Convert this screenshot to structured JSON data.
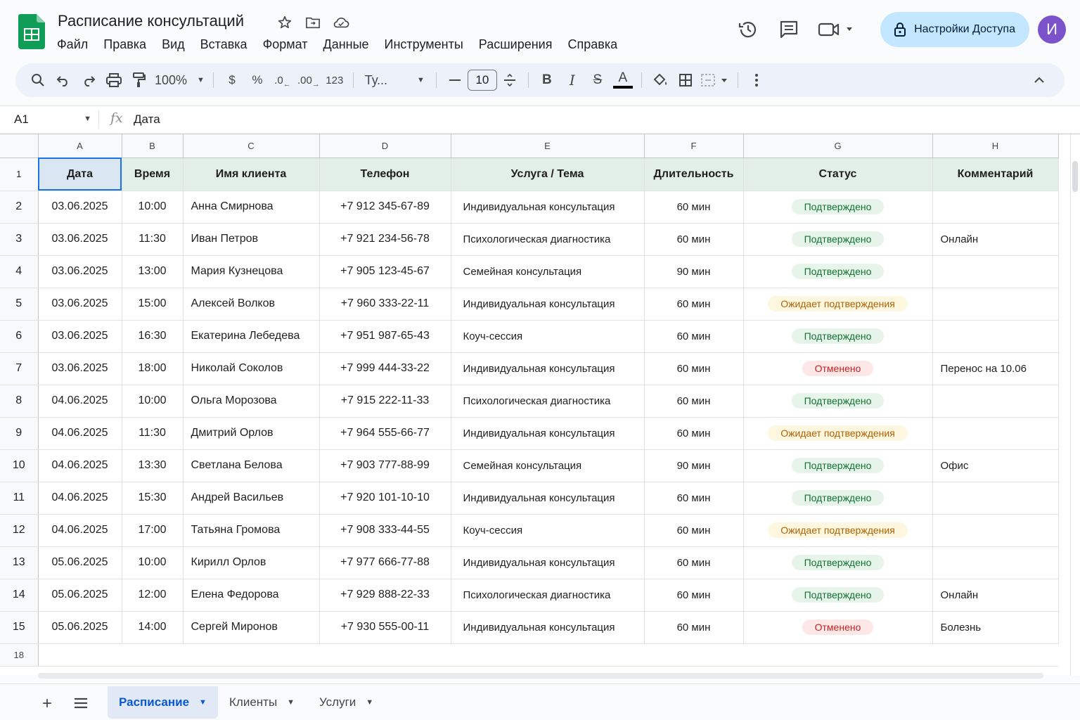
{
  "doc": {
    "title": "Расписание консультаций"
  },
  "menu": [
    "Файл",
    "Правка",
    "Вид",
    "Вставка",
    "Формат",
    "Данные",
    "Инструменты",
    "Расширения",
    "Справка"
  ],
  "share": {
    "label": "Настройки Доступа"
  },
  "avatar": {
    "initial": "И",
    "color": "#7b52c9"
  },
  "toolbar": {
    "zoom": "100%",
    "currency": "$",
    "percent": "%",
    "dec_less": ".0",
    "dec_more": ".00",
    "number_format": "123",
    "font": "Ту...",
    "font_size": "10",
    "bold": "B",
    "italic": "I",
    "strike": "S",
    "text_color": "A"
  },
  "formula_bar": {
    "cell_ref": "A1",
    "fx": "fx",
    "value": "Дата"
  },
  "columns": [
    "A",
    "B",
    "C",
    "D",
    "E",
    "F",
    "G",
    "H"
  ],
  "header_row": {
    "num": "1",
    "cells": [
      "Дата",
      "Время",
      "Имя клиента",
      "Телефон",
      "Услуга / Тема",
      "Длительность",
      "Статус",
      "Комментарий"
    ]
  },
  "rows": [
    {
      "num": "2",
      "date": "03.06.2025",
      "time": "10:00",
      "name": "Анна Смирнова",
      "phone": "+7 912 345-67-89",
      "service": "Индивидуальная консультация",
      "duration": "60 мин",
      "status": "Подтверждено",
      "status_kind": "ok",
      "comment": ""
    },
    {
      "num": "3",
      "date": "03.06.2025",
      "time": "11:30",
      "name": "Иван Петров",
      "phone": "+7 921 234-56-78",
      "service": "Психологическая диагностика",
      "duration": "60 мин",
      "status": "Подтверждено",
      "status_kind": "ok",
      "comment": "Онлайн"
    },
    {
      "num": "4",
      "date": "03.06.2025",
      "time": "13:00",
      "name": "Мария Кузнецова",
      "phone": "+7 905 123-45-67",
      "service": "Семейная консультация",
      "duration": "90 мин",
      "status": "Подтверждено",
      "status_kind": "ok",
      "comment": ""
    },
    {
      "num": "5",
      "date": "03.06.2025",
      "time": "15:00",
      "name": "Алексей Волков",
      "phone": "+7 960 333-22-11",
      "service": "Индивидуальная консультация",
      "duration": "60 мин",
      "status": "Ожидает подтверждения",
      "status_kind": "wait",
      "comment": ""
    },
    {
      "num": "6",
      "date": "03.06.2025",
      "time": "16:30",
      "name": "Екатерина Лебедева",
      "phone": "+7 951 987-65-43",
      "service": "Коуч-сессия",
      "duration": "60 мин",
      "status": "Подтверждено",
      "status_kind": "ok",
      "comment": ""
    },
    {
      "num": "7",
      "date": "03.06.2025",
      "time": "18:00",
      "name": "Николай Соколов",
      "phone": "+7 999 444-33-22",
      "service": "Индивидуальная консультация",
      "duration": "60 мин",
      "status": "Отменено",
      "status_kind": "cancel",
      "comment": "Перенос на 10.06"
    },
    {
      "num": "8",
      "date": "04.06.2025",
      "time": "10:00",
      "name": "Ольга Морозова",
      "phone": "+7 915 222-11-33",
      "service": "Психологическая диагностика",
      "duration": "60 мин",
      "status": "Подтверждено",
      "status_kind": "ok",
      "comment": ""
    },
    {
      "num": "9",
      "date": "04.06.2025",
      "time": "11:30",
      "name": "Дмитрий Орлов",
      "phone": "+7 964 555-66-77",
      "service": "Индивидуальная консультация",
      "duration": "60 мин",
      "status": "Ожидает подтверждения",
      "status_kind": "wait",
      "comment": ""
    },
    {
      "num": "10",
      "date": "04.06.2025",
      "time": "13:30",
      "name": "Светлана Белова",
      "phone": "+7 903 777-88-99",
      "service": "Семейная консультация",
      "duration": "90 мин",
      "status": "Подтверждено",
      "status_kind": "ok",
      "comment": "Офис"
    },
    {
      "num": "11",
      "date": "04.06.2025",
      "time": "15:30",
      "name": "Андрей Васильев",
      "phone": "+7 920 101-10-10",
      "service": "Индивидуальная консультация",
      "duration": "60 мин",
      "status": "Подтверждено",
      "status_kind": "ok",
      "comment": ""
    },
    {
      "num": "12",
      "date": "04.06.2025",
      "time": "17:00",
      "name": "Татьяна Громова",
      "phone": "+7 908 333-44-55",
      "service": "Коуч-сессия",
      "duration": "60 мин",
      "status": "Ожидает подтверждения",
      "status_kind": "wait",
      "comment": ""
    },
    {
      "num": "13",
      "date": "05.06.2025",
      "time": "10:00",
      "name": "Кирилл Орлов",
      "phone": "+7 977 666-77-88",
      "service": "Индивидуальная консультация",
      "duration": "60 мин",
      "status": "Подтверждено",
      "status_kind": "ok",
      "comment": ""
    },
    {
      "num": "14",
      "date": "05.06.2025",
      "time": "12:00",
      "name": "Елена Федорова",
      "phone": "+7 929 888-22-33",
      "service": "Психологическая диагностика",
      "duration": "60 мин",
      "status": "Подтверждено",
      "status_kind": "ok",
      "comment": "Онлайн"
    },
    {
      "num": "15",
      "date": "05.06.2025",
      "time": "14:00",
      "name": "Сергей Миронов",
      "phone": "+7 930 555-00-11",
      "service": "Индивидуальная консультация",
      "duration": "60 мин",
      "status": "Отменено",
      "status_kind": "cancel",
      "comment": "Болезнь"
    }
  ],
  "empty_row": {
    "num": "18"
  },
  "sheets": [
    {
      "label": "Расписание",
      "active": true
    },
    {
      "label": "Клиенты",
      "active": false
    },
    {
      "label": "Услуги",
      "active": false
    }
  ],
  "colors": {
    "accent": "#0b57d0",
    "header_fill": "#e2efe6",
    "share_bg": "#c2e7ff"
  }
}
